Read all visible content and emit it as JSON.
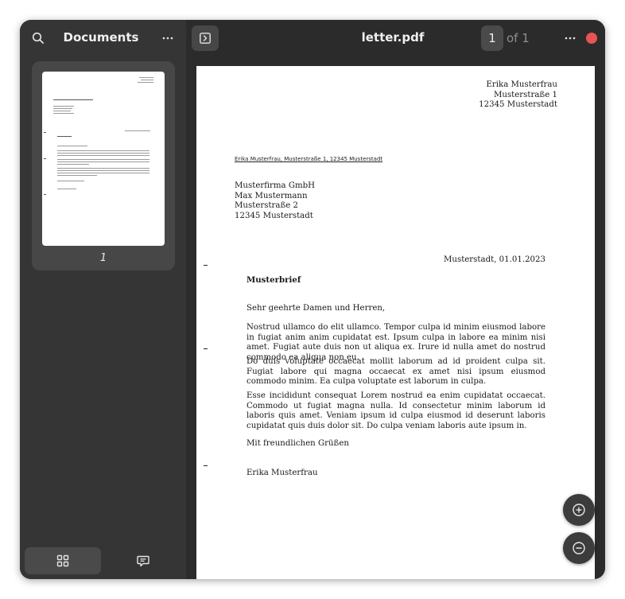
{
  "sidebar": {
    "title": "Documents",
    "thumbnail_label": "1"
  },
  "header": {
    "doc_title": "letter.pdf",
    "current_page": "1",
    "page_of": "of 1"
  },
  "document": {
    "sender": [
      "Erika Musterfrau",
      "Musterstraße 1",
      "12345 Musterstadt"
    ],
    "return_line": "Erika Musterfrau, Musterstraße 1, 12345 Musterstadt",
    "recipient": [
      "Musterfirma GmbH",
      "Max Mustermann",
      "Musterstraße 2",
      "12345 Musterstadt"
    ],
    "date": "Musterstadt, 01.01.2023",
    "subject": "Musterbrief",
    "salutation": "Sehr geehrte Damen und Herren,",
    "paragraphs": [
      "Nostrud ullamco do elit ullamco. Tempor culpa id minim eiusmod labore in fugiat anim anim cupidatat est. Ipsum culpa in labore ea minim nisi amet. Fugiat aute duis non ut aliqua ex. Irure id nulla amet do nostrud commodo ea aliqua non eu.",
      "Do duis voluptate occaecat mollit laborum ad id proident culpa sit. Fugiat labore qui magna occaecat ex amet nisi ipsum eiusmod commodo minim. Ea culpa voluptate est laborum in culpa.",
      "Esse incididunt consequat Lorem nostrud ea enim cupidatat occaecat. Commodo ut fugiat magna nulla. Id consectetur minim laborum id laboris quis amet. Veniam ipsum id culpa eiusmod id deserunt laboris cupidatat quis duis dolor sit. Do culpa veniam laboris aute ipsum in."
    ],
    "closing": "Mit freundlichen Grüßen",
    "signature": "Erika Musterfrau"
  },
  "icons": {
    "search": "search-icon",
    "menu": "more-icon",
    "sidebar_toggle": "sidebar-toggle-icon",
    "grid": "grid-icon",
    "annotations": "comment-icon",
    "zoom_in": "zoom-in-icon",
    "zoom_out": "zoom-out-icon"
  },
  "colors": {
    "close": "#e65454",
    "sidebar": "#353535",
    "content": "#2b2b2b"
  }
}
